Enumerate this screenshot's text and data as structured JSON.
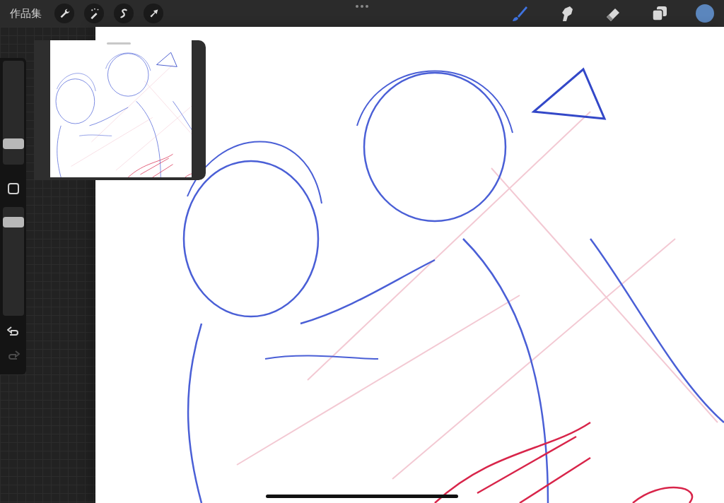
{
  "top_bar": {
    "gallery_label": "作品集",
    "actions": [
      {
        "kind": "wrench"
      },
      {
        "kind": "wand"
      },
      {
        "kind": "selection"
      },
      {
        "kind": "transform"
      }
    ],
    "tools": [
      {
        "kind": "brush",
        "selected": true
      },
      {
        "kind": "smudge",
        "selected": false
      },
      {
        "kind": "eraser",
        "selected": false
      },
      {
        "kind": "layers",
        "selected": false
      }
    ],
    "color": "#5b86bd"
  },
  "sidebar": {
    "size_slider": {
      "level": 0.17
    },
    "opacity_slider": {
      "level": 0.9
    },
    "undo": {
      "disabled": false
    },
    "redo": {
      "disabled": true
    }
  }
}
